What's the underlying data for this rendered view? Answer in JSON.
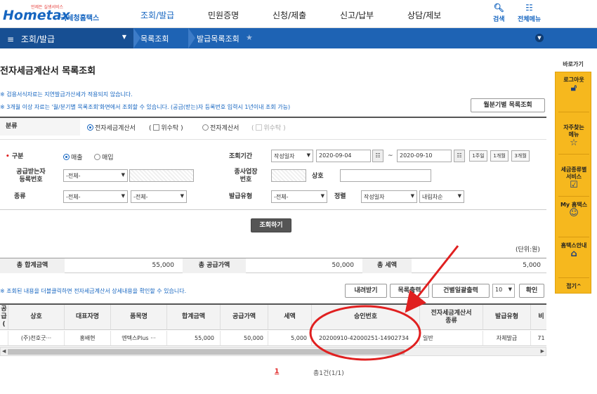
{
  "header": {
    "logo_text": "Hometax",
    "logo_tagline": "언제든 실생서비스",
    "logo_kr": "국세청홈택스",
    "menu": [
      "조회/발급",
      "민원증명",
      "신청/제출",
      "신고/납부",
      "상담/제보"
    ],
    "search_label": "검색",
    "allmenu_label": "전체메뉴"
  },
  "nav": {
    "section": "조회/발급",
    "crumbs": [
      "목록조회",
      "발급목록조회"
    ]
  },
  "page": {
    "title": "전자세금계산서 목록조회",
    "notes": [
      "※ 검용서식자료는 지연발급가산세가 적용되지 않습니다.",
      "※ 3개월 이상 자료는 '월/분기별 목록조회'화면에서 조회할 수 있습니다. (공급(받는)자 등록번호 입력시 1년이내 조회 가능)"
    ],
    "monthly_button": "월분기별 목록조회"
  },
  "form": {
    "category_label": "분류",
    "category_options": [
      "전자세금계산서",
      "위수탁",
      "전자계산서",
      "위수탁"
    ],
    "type_label": "구분",
    "type_options": [
      "매출",
      "매입"
    ],
    "period_label": "조회기간",
    "period_select": "작성일자",
    "date_from": "2020-09-04",
    "date_sep": "~",
    "date_to": "2020-09-10",
    "quick_periods": [
      "1주일",
      "1개월",
      "3개월"
    ],
    "supplier_label": "공급받는자\n등록번호",
    "supplier_select": "-전체-",
    "subbiz_label": "종사업장\n번호",
    "company_label": "상호",
    "kind_label": "종류",
    "kind_select1": "-전체-",
    "kind_select2": "-전체-",
    "issue_type_label": "발급유형",
    "issue_type_select": "-전체-",
    "sort_label": "정렬",
    "sort_select": "작성일자",
    "order_select": "내림차순",
    "search_button": "조회하기"
  },
  "totals": {
    "unit": "(단위:원)",
    "total_amount_label": "총 합계금액",
    "total_amount": "55,000",
    "supply_label": "총 공급가액",
    "supply": "50,000",
    "tax_label": "총 세액",
    "tax": "5,000"
  },
  "list": {
    "note": "※ 조회된 내용을 더블클릭하면 전자세금계산서 상세내용을 확인할 수 있습니다.",
    "download_button": "내려받기",
    "print_button": "목록출력",
    "bulk_print_button": "건별일괄출력",
    "page_size": "10",
    "confirm_button": "확인",
    "headers": [
      "공급(",
      "상호",
      "대표자명",
      "품목명",
      "합계금액",
      "공급가액",
      "세액",
      "승인번호",
      "전자세금계산서\n종류",
      "발급유형",
      "비"
    ],
    "rows": [
      [
        "",
        "(주)천호굿···",
        "홍배현",
        "엔텍스Plus ···",
        "55,000",
        "50,000",
        "5,000",
        "20200910-42000251-14902734",
        "일반",
        "자체발급",
        "71"
      ]
    ]
  },
  "pager": {
    "current": "1",
    "summary": "총1건(1/1)"
  },
  "quick": {
    "title": "바로가기",
    "items": [
      "로그아웃",
      "자주찾는\n메뉴",
      "세금종류별\n서비스",
      "My 홈택스",
      "홈택스안내"
    ],
    "fold": "접기^"
  },
  "colors": {
    "brand_blue": "#1e63b4",
    "annotation_red": "#e02020",
    "quick_yellow": "#f6b81e"
  }
}
